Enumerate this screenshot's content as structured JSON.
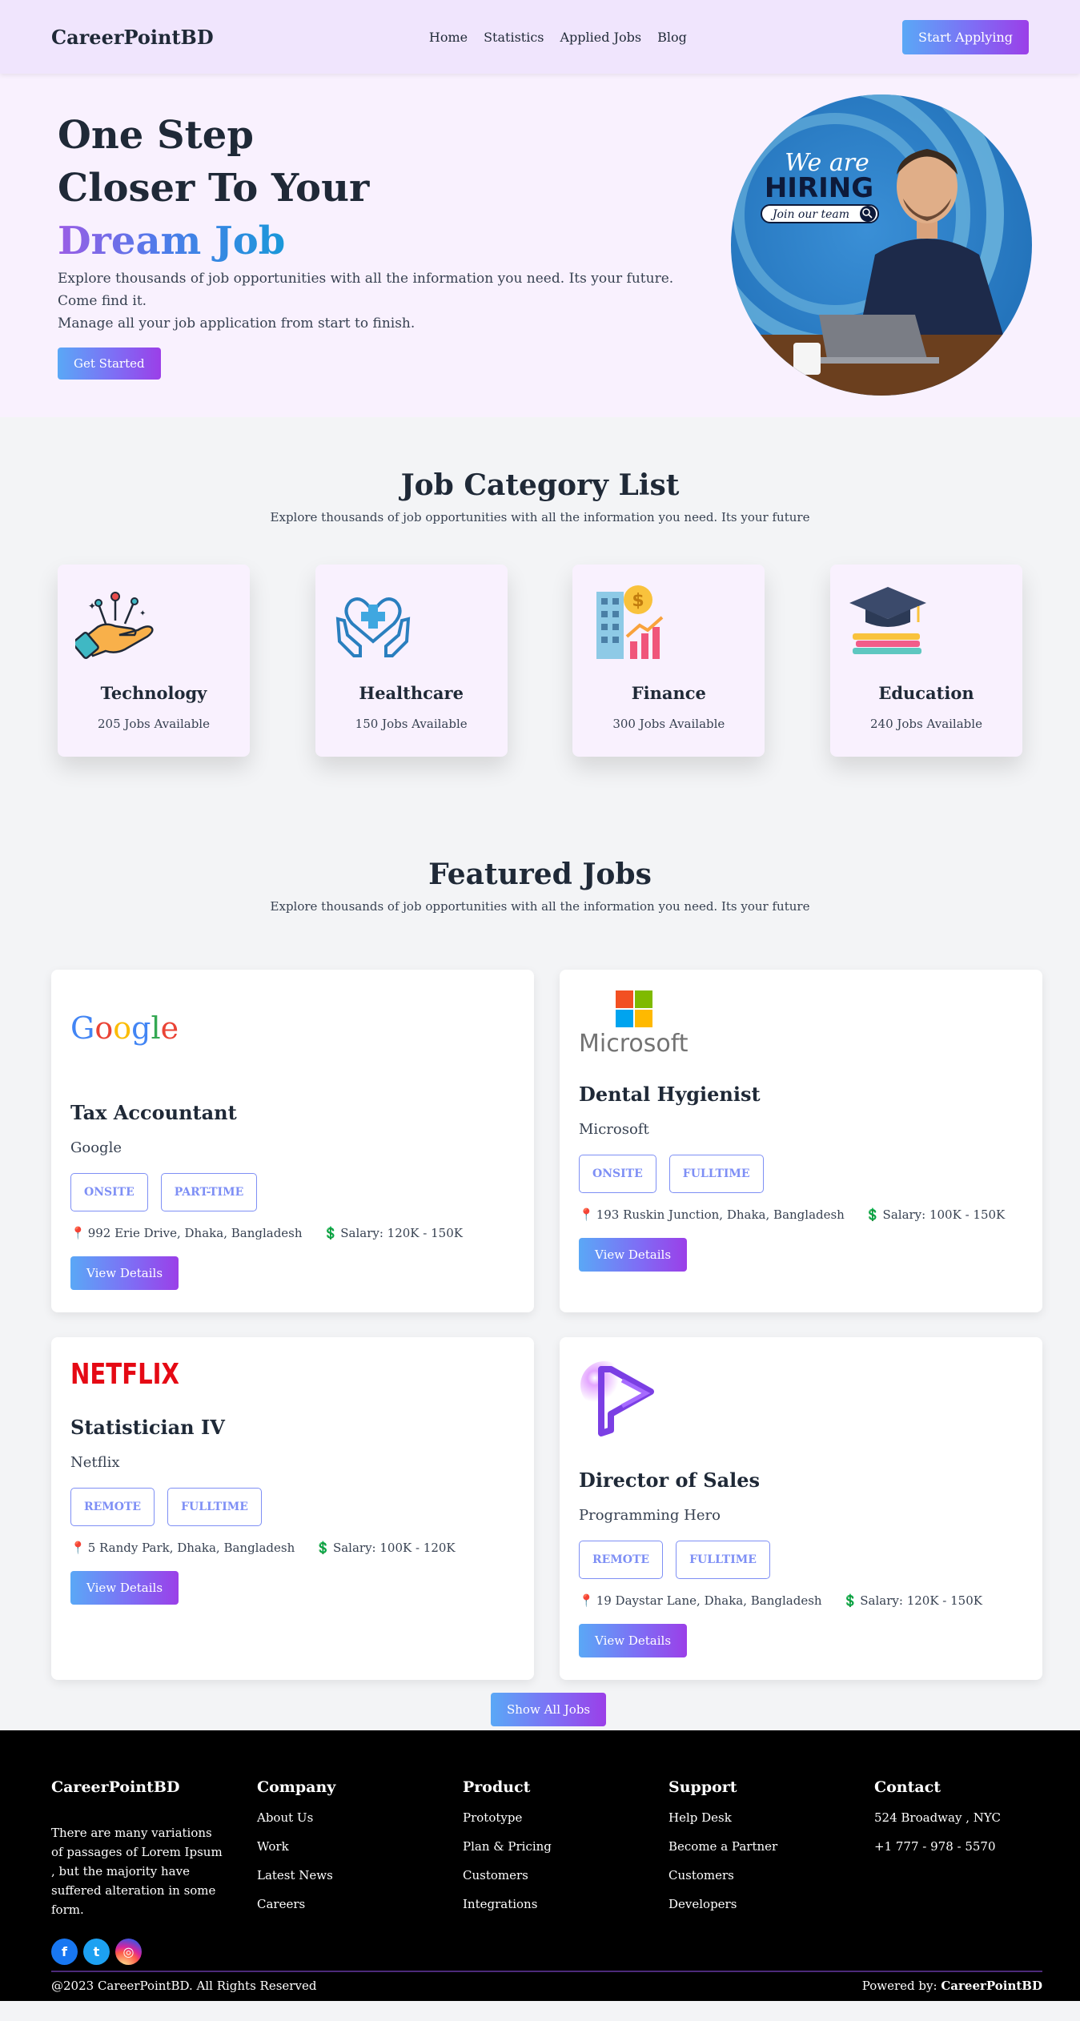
{
  "nav": {
    "brand": "CareerPointBD",
    "links": [
      "Home",
      "Statistics",
      "Applied Jobs",
      "Blog"
    ],
    "cta": "Start Applying"
  },
  "hero": {
    "line1": "One Step",
    "line2": "Closer To Your",
    "line3": "Dream Job",
    "desc1": "Explore thousands of job opportunities with all the information you need. Its your future. Come find it.",
    "desc2": "Manage all your job application from start to finish.",
    "button": "Get Started",
    "image_text": {
      "we_are": "We are",
      "hiring": "HIRING",
      "join": "Join our team"
    }
  },
  "categories": {
    "title": "Job Category List",
    "subtitle": "Explore thousands of job opportunities with all the information you need. Its your future",
    "items": [
      {
        "name": "Technology",
        "count": "205 Jobs Available",
        "icon": "hand-circuit-icon"
      },
      {
        "name": "Healthcare",
        "count": "150 Jobs Available",
        "icon": "heart-cross-hands-icon"
      },
      {
        "name": "Finance",
        "count": "300 Jobs Available",
        "icon": "building-dollar-chart-icon"
      },
      {
        "name": "Education",
        "count": "240 Jobs Available",
        "icon": "graduation-cap-books-icon"
      }
    ]
  },
  "featured": {
    "title": "Featured Jobs",
    "subtitle": "Explore thousands of job opportunities with all the information you need. Its your future",
    "jobs": [
      {
        "logo_text": "Google",
        "title": "Tax Accountant",
        "company": "Google",
        "tags": [
          "ONSITE",
          "PART-TIME"
        ],
        "location": "992 Erie Drive, Dhaka, Bangladesh",
        "salary": "Salary: 120K - 150K",
        "button": "View Details"
      },
      {
        "logo_text": "Microsoft",
        "title": "Dental Hygienist",
        "company": "Microsoft",
        "tags": [
          "ONSITE",
          "FULLTIME"
        ],
        "location": "193 Ruskin Junction, Dhaka, Bangladesh",
        "salary": "Salary: 100K - 150K",
        "button": "View Details"
      },
      {
        "logo_text": "NETFLIX",
        "title": "Statistician IV",
        "company": "Netflix",
        "tags": [
          "REMOTE",
          "FULLTIME"
        ],
        "location": "5 Randy Park, Dhaka, Bangladesh",
        "salary": "Salary: 100K - 120K",
        "button": "View Details"
      },
      {
        "logo_text": "",
        "title": "Director of Sales",
        "company": "Programming Hero",
        "tags": [
          "REMOTE",
          "FULLTIME"
        ],
        "location": "19 Daystar Lane, Dhaka, Bangladesh",
        "salary": "Salary: 120K - 150K",
        "button": "View Details"
      }
    ],
    "show_all": "Show All Jobs"
  },
  "footer": {
    "brand": "CareerPointBD",
    "desc": "There are many variations of passages of Lorem Ipsum , but the majority have suffered alteration in some form.",
    "columns": [
      {
        "heading": "Company",
        "items": [
          "About Us",
          "Work",
          "Latest News",
          "Careers"
        ]
      },
      {
        "heading": "Product",
        "items": [
          "Prototype",
          "Plan & Pricing",
          "Customers",
          "Integrations"
        ]
      },
      {
        "heading": "Support",
        "items": [
          "Help Desk",
          "Become a Partner",
          "Customers",
          "Developers"
        ]
      },
      {
        "heading": "Contact",
        "items": [
          "524 Broadway , NYC",
          "+1 777 - 978 - 5570"
        ]
      }
    ],
    "socials": [
      "facebook-icon",
      "twitter-icon",
      "instagram-icon"
    ],
    "copyright": "@2023 CareerPointBD. All Rights Reserved",
    "powered_label": "Powered by: ",
    "powered_brand": "CareerPointBD"
  },
  "colors": {
    "nav_bg": "#f0e5fd",
    "hero_bg": "#f9f1fe",
    "page_bg": "#f3f4f6",
    "gradient_start": "#5aa8f6",
    "gradient_end": "#9b3fe8",
    "tag_color": "#7e8ff5",
    "footer_bg": "#000000"
  }
}
